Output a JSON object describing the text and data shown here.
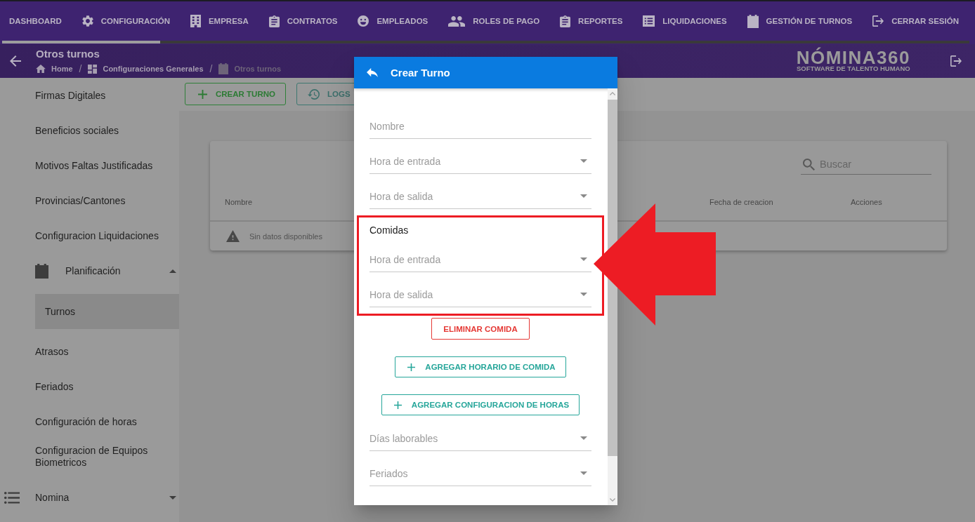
{
  "nav": {
    "items": [
      {
        "label": "DASHBOARD"
      },
      {
        "label": "CONFIGURACIÓN"
      },
      {
        "label": "EMPRESA"
      },
      {
        "label": "CONTRATOS"
      },
      {
        "label": "EMPLEADOS"
      },
      {
        "label": "ROLES DE PAGO"
      },
      {
        "label": "REPORTES"
      },
      {
        "label": "LIQUIDACIONES"
      },
      {
        "label": "GESTIÓN DE TURNOS"
      },
      {
        "label": "CERRAR SESIÓN"
      }
    ]
  },
  "header": {
    "title": "Otros turnos",
    "breadcrumb": {
      "separator": "/",
      "items": [
        {
          "label": "Home",
          "current": false
        },
        {
          "label": "Configuraciones Generales",
          "current": false
        },
        {
          "label": "Otros turnos",
          "current": true
        }
      ]
    }
  },
  "logo": {
    "title": "NÓMINA360",
    "tagline": "SOFTWARE DE TALENTO HUMANO"
  },
  "sidebar": {
    "items": [
      {
        "label": "Firmas Digitales",
        "kind": "link",
        "selected": false
      },
      {
        "label": "Beneficios sociales",
        "kind": "link",
        "selected": false
      },
      {
        "label": "Motivos Faltas Justificadas",
        "kind": "link",
        "selected": false
      },
      {
        "label": "Provincias/Cantones",
        "kind": "link",
        "selected": false
      },
      {
        "label": "Configuracion Liquidaciones",
        "kind": "link",
        "selected": false
      },
      {
        "label": "Planificación",
        "kind": "group",
        "selected": false,
        "expanded": true,
        "children": [
          {
            "label": "Turnos",
            "kind": "link",
            "selected": true
          }
        ]
      },
      {
        "label": "Atrasos",
        "kind": "link",
        "selected": false
      },
      {
        "label": "Feriados",
        "kind": "link",
        "selected": false
      },
      {
        "label": "Configuración de horas",
        "kind": "link",
        "selected": false
      },
      {
        "label": "Configuracion de Equipos Biometricos",
        "kind": "link",
        "selected": false
      },
      {
        "label": "Nomina",
        "kind": "section",
        "selected": false,
        "expanded": false
      }
    ]
  },
  "toolbar": {
    "buttons": [
      {
        "label": "CREAR TURNO"
      },
      {
        "label": "LOGS"
      }
    ]
  },
  "table": {
    "search": {
      "placeholder": "Buscar"
    },
    "columns": [
      "Nombre",
      "Fecha de creacion",
      "Acciones"
    ],
    "empty_message": "Sin datos disponibles"
  },
  "dialog": {
    "title": "Crear Turno",
    "fields": [
      {
        "placeholder": "Nombre",
        "kind": "text"
      },
      {
        "placeholder": "Hora de entrada",
        "kind": "select"
      },
      {
        "placeholder": "Hora de salida",
        "kind": "select"
      }
    ],
    "meals": {
      "title": "Comidas",
      "fields": [
        {
          "placeholder": "Hora de entrada",
          "kind": "select"
        },
        {
          "placeholder": "Hora de salida",
          "kind": "select"
        }
      ],
      "remove_button": "ELIMINAR COMIDA"
    },
    "add_meal_button": "AGREGAR HORARIO DE COMIDA",
    "add_hours_button": "AGREGAR CONFIGURACION DE HORAS",
    "more_fields": [
      {
        "placeholder": "Días laborables",
        "kind": "select"
      },
      {
        "placeholder": "Feriados",
        "kind": "select"
      }
    ]
  }
}
